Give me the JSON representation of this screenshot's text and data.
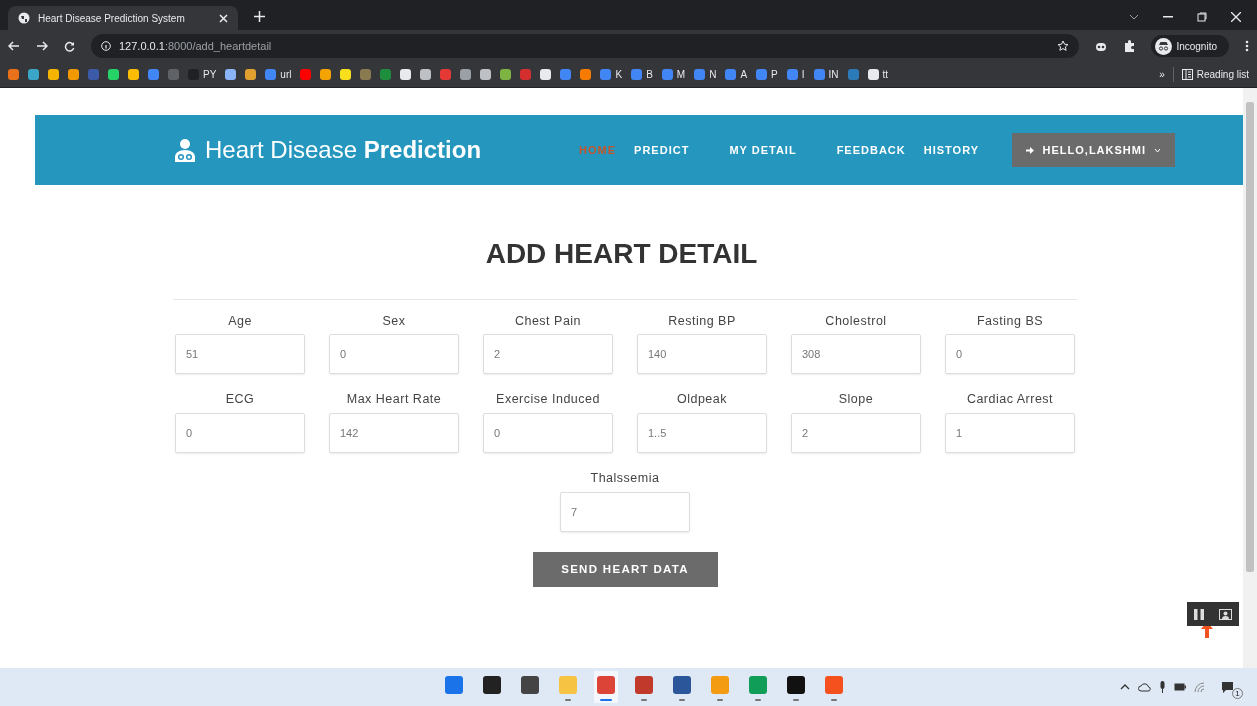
{
  "browser": {
    "tab_title": "Heart Disease Prediction System",
    "url_host": "127.0.0.1",
    "url_path": ":8000/add_heartdetail",
    "profile": "Incognito",
    "bookmarks": [
      {
        "color": "#e8711a"
      },
      {
        "color": "#3aa6c7"
      },
      {
        "color": "#f4b400"
      },
      {
        "color": "#f29900"
      },
      {
        "color": "#3b5ba9"
      },
      {
        "color": "#25d366"
      },
      {
        "color": "#fbbc04"
      },
      {
        "color": "#4285f4"
      },
      {
        "color": "#5f6368"
      },
      {
        "label": "PY",
        "color": "#202124"
      },
      {
        "color": "#8ab4f8"
      },
      {
        "color": "#e0a030"
      },
      {
        "label": "url",
        "color": "#4285f4"
      },
      {
        "color": "#ff0000"
      },
      {
        "color": "#f4a300"
      },
      {
        "color": "#f7e01b"
      },
      {
        "color": "#8a7a50"
      },
      {
        "color": "#1e8e3e"
      },
      {
        "color": "#e8eaed"
      },
      {
        "color": "#bdc1c6"
      },
      {
        "color": "#e53935"
      },
      {
        "color": "#9aa0a6"
      },
      {
        "color": "#bdc1c6"
      },
      {
        "color": "#7cb342"
      },
      {
        "color": "#d32f2f"
      },
      {
        "color": "#e8eaed"
      },
      {
        "color": "#4285f4"
      },
      {
        "color": "#f57c00"
      },
      {
        "label": "K",
        "color": "#4285f4"
      },
      {
        "label": "B",
        "color": "#4285f4"
      },
      {
        "label": "M",
        "color": "#4285f4"
      },
      {
        "label": "N",
        "color": "#4285f4"
      },
      {
        "label": "A",
        "color": "#4285f4"
      },
      {
        "label": "P",
        "color": "#4285f4"
      },
      {
        "label": "I",
        "color": "#4285f4"
      },
      {
        "label": "IN",
        "color": "#4285f4"
      },
      {
        "color": "#2b7bb9"
      },
      {
        "label": "tt",
        "color": "#e8eaed"
      }
    ],
    "overflow": "»",
    "reading_list": "Reading list"
  },
  "brand": {
    "light": "Heart Disease",
    "bold": "Prediction"
  },
  "nav": [
    {
      "label": "HOME",
      "selected": true
    },
    {
      "label": "PREDICT",
      "selected": false
    },
    {
      "label": "MY DETAIL",
      "selected": false
    },
    {
      "label": "FEEDBACK",
      "selected": false
    },
    {
      "label": "HISTORY",
      "selected": false
    }
  ],
  "user_menu": {
    "label": "HELLO,LAKSHMI",
    "expanded": false
  },
  "heading": "ADD HEART DETAIL",
  "fields": [
    {
      "label": "Age",
      "value": "51"
    },
    {
      "label": "Sex",
      "value": "0"
    },
    {
      "label": "Chest Pain",
      "value": "2"
    },
    {
      "label": "Resting BP",
      "value": "140"
    },
    {
      "label": "Cholestrol",
      "value": "308"
    },
    {
      "label": "Fasting BS",
      "value": "0"
    },
    {
      "label": "ECG",
      "value": "0"
    },
    {
      "label": "Max Heart Rate",
      "value": "142"
    },
    {
      "label": "Exercise Induced",
      "value": "0"
    },
    {
      "label": "Oldpeak",
      "value": "1..5"
    },
    {
      "label": "Slope",
      "value": "2"
    },
    {
      "label": "Cardiac Arrest",
      "value": "1"
    },
    {
      "label": "Thalssemia",
      "value": "7"
    }
  ],
  "submit": "SEND HEART DATA",
  "taskbar": {
    "apps": [
      {
        "color": "#1a73e8",
        "running": false
      },
      {
        "color": "#222222",
        "running": false
      },
      {
        "color": "#444444",
        "running": false
      },
      {
        "color": "#f6c342",
        "running": true
      },
      {
        "color": "#db4437",
        "running": true,
        "selected": true
      },
      {
        "color": "#c0392b",
        "running": true
      },
      {
        "color": "#2b579a",
        "running": true
      },
      {
        "color": "#f39c12",
        "running": true
      },
      {
        "color": "#0f9d58",
        "running": true
      },
      {
        "color": "#111111",
        "running": true
      },
      {
        "color": "#f4511e",
        "running": true
      }
    ],
    "notification_count": "1"
  }
}
